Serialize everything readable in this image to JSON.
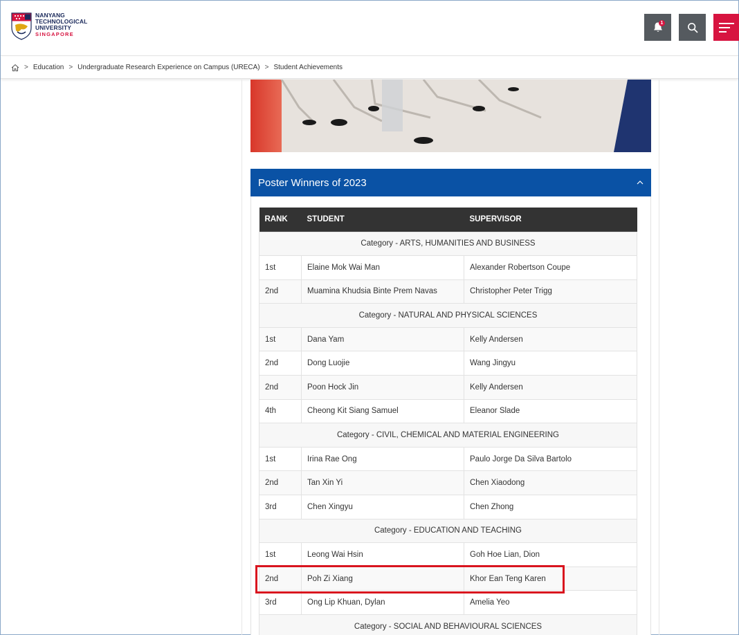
{
  "header": {
    "logo_lines": [
      "NANYANG",
      "TECHNOLOGICAL",
      "UNIVERSITY"
    ],
    "logo_sub": "SINGAPORE",
    "notification_count": "1",
    "colors": {
      "brand_red": "#d71440",
      "brand_navy": "#1b2a5b",
      "button_gray": "#555a5f"
    }
  },
  "breadcrumb": {
    "items": [
      "Education",
      "Undergraduate Research Experience on Campus (URECA)",
      "Student Achievements"
    ],
    "separator": ">"
  },
  "accordion": {
    "title": "Poster Winners of 2023",
    "color": "#0a52a5"
  },
  "table": {
    "headers": [
      "RANK",
      "STUDENT",
      "SUPERVISOR"
    ],
    "rows": [
      {
        "type": "category",
        "label": "Category - ARTS, HUMANITIES  AND BUSINESS"
      },
      {
        "rank": "1st",
        "student": "Elaine Mok Wai Man",
        "supervisor": "Alexander Robertson Coupe"
      },
      {
        "rank": "2nd",
        "student": "Muamina Khudsia Binte Prem Navas",
        "supervisor": "Christopher Peter Trigg"
      },
      {
        "type": "category",
        "label": "Category - NATURAL AND PHYSICAL SCIENCES"
      },
      {
        "rank": "1st",
        "student": "Dana Yam",
        "supervisor": "Kelly Andersen"
      },
      {
        "rank": "2nd",
        "student": "Dong Luojie",
        "supervisor": "Wang Jingyu"
      },
      {
        "rank": "2nd",
        "student": "Poon Hock Jin",
        "supervisor": "Kelly Andersen"
      },
      {
        "rank": "4th",
        "student": "Cheong Kit Siang Samuel",
        "supervisor": "Eleanor Slade"
      },
      {
        "type": "category",
        "label": "Category - CIVIL, CHEMICAL AND MATERIAL ENGINEERING"
      },
      {
        "rank": "1st",
        "student": "Irina Rae Ong",
        "supervisor": "Paulo Jorge Da Silva Bartolo"
      },
      {
        "rank": "2nd",
        "student": "Tan Xin Yi",
        "supervisor": "Chen Xiaodong"
      },
      {
        "rank": "3rd",
        "student": "Chen Xingyu",
        "supervisor": "Chen Zhong"
      },
      {
        "type": "category",
        "label": "Category - EDUCATION AND TEACHING"
      },
      {
        "rank": "1st",
        "student": "Leong Wai Hsin",
        "supervisor": "Goh Hoe Lian, Dion"
      },
      {
        "rank": "2nd",
        "student": "Poh Zi Xiang",
        "supervisor": "Khor Ean Teng Karen",
        "highlighted": true
      },
      {
        "rank": "3rd",
        "student": "Ong Lip Khuan, Dylan",
        "supervisor": "Amelia Yeo"
      },
      {
        "type": "category",
        "label": "Category - SOCIAL AND BEHAVIOURAL SCIENCES"
      }
    ]
  },
  "highlight_color": "#d9141e"
}
